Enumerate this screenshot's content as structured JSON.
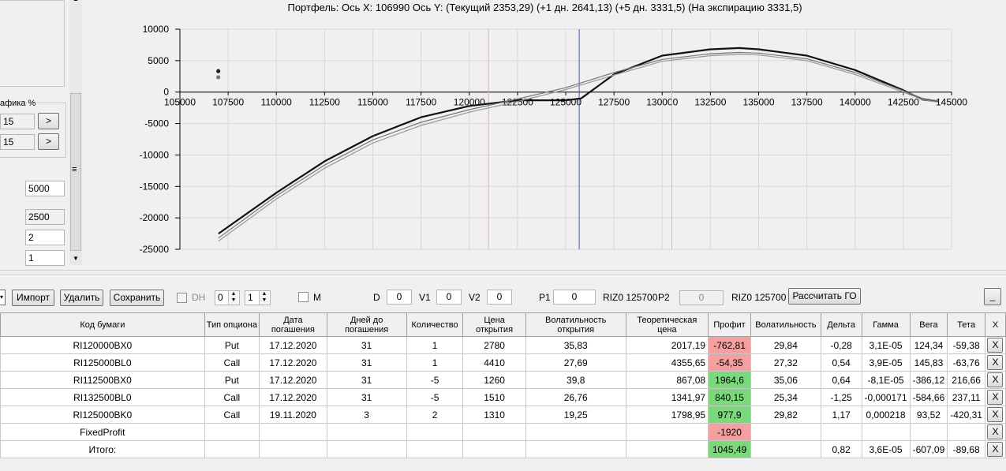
{
  "chart": {
    "title": "Портфель: Ось X: 106990 Ось Y:  (Текущий 2353,29)  (+1 дн. 2641,13)  (+5 дн. 3331,5)  (На экспирацию 3331,5)",
    "x_ticks": [
      "105000",
      "107500",
      "110000",
      "112500",
      "115000",
      "117500",
      "120000",
      "122500",
      "125000",
      "127500",
      "130000",
      "132500",
      "135000",
      "137500",
      "140000",
      "142500",
      "145000"
    ],
    "y_ticks": [
      "10000",
      "5000",
      "0",
      "-5000",
      "-10000",
      "-15000",
      "-20000",
      "-25000"
    ]
  },
  "chart_data": {
    "type": "line",
    "title": "Портфель: Ось X: 106990 Ось Y:  (Текущий 2353,29)  (+1 дн. 2641,13)  (+5 дн. 3331,5)  (На экспирацию 3331,5)",
    "xlim": [
      105000,
      145000
    ],
    "ylim": [
      -25000,
      10000
    ],
    "grid": true,
    "series": [
      {
        "x": [
          107000,
          110000,
          112500,
          115000,
          117500,
          120000,
          122500,
          125000,
          125800,
          127500,
          130000,
          132500,
          134000,
          135000,
          137500,
          140000,
          142500,
          143500,
          144300
        ],
        "y": [
          -22500,
          -16000,
          -11000,
          -7000,
          -4000,
          -2200,
          -1300,
          -1300,
          -1000,
          2800,
          5800,
          6800,
          7000,
          6800,
          5800,
          3500,
          300,
          -1200,
          -1500
        ]
      },
      {
        "x": [
          107000,
          110000,
          112500,
          115000,
          117500,
          120000,
          122500,
          125000,
          127500,
          130000,
          132500,
          134000,
          135000,
          137500,
          140000,
          142500,
          143500,
          144300
        ],
        "y": [
          -23200,
          -16500,
          -11600,
          -7600,
          -4800,
          -2800,
          -1100,
          700,
          3100,
          5200,
          6100,
          6300,
          6200,
          5300,
          3100,
          200,
          -1000,
          -1400
        ]
      },
      {
        "x": [
          107000,
          110000,
          112500,
          115000,
          117500,
          120000,
          122500,
          125000,
          127500,
          130000,
          132500,
          134000,
          135000,
          137500,
          140000,
          142500,
          143500,
          144300
        ],
        "y": [
          -23700,
          -17000,
          -12100,
          -8100,
          -5300,
          -3200,
          -1500,
          400,
          2700,
          4900,
          5800,
          6000,
          5900,
          5000,
          2800,
          0,
          -1200,
          -1600
        ]
      }
    ],
    "points": [
      {
        "x": 106990,
        "y": 3331.5
      },
      {
        "x": 106990,
        "y": 2353.29
      }
    ],
    "vertical_lines": [
      {
        "x": 121000,
        "color": "#f4a6b0"
      },
      {
        "x": 125700,
        "color": "#4a5aa0"
      },
      {
        "x": 130500,
        "color": "#f4a6b0"
      }
    ]
  },
  "left_panel": {
    "group_label": "афика %",
    "field1": "15",
    "field2": "15",
    "arrow_btn": ">",
    "field3": "5000",
    "field4": "2500",
    "field5": "2",
    "field6": "1",
    "grip": "≡",
    "scroll_up": "▲",
    "scroll_down": "▼"
  },
  "toolbar": {
    "dropdown_arrow": "▾",
    "import": "Импорт",
    "delete": "Удалить",
    "save": "Сохранить",
    "dh_label": "DH",
    "spin1": "0",
    "spin2": "1",
    "spin_up": "▲",
    "spin_down": "▼",
    "m_label": "M",
    "d_label": "D",
    "d_value": "0",
    "v1_label": "V1",
    "v1_value": "0",
    "v2_label": "V2",
    "v2_value": "0",
    "p1_label": "P1",
    "p1_value": "0",
    "riz1": "RIZ0 125700",
    "p2_label": "P2",
    "p2_value": "0",
    "riz2": "RIZ0 125700",
    "calc": "Рассчитать ГО",
    "minimize": "_"
  },
  "table": {
    "headers": [
      "Код бумаги",
      "Тип опциона",
      "Дата погашения",
      "Дней до погашения",
      "Количество",
      "Цена открытия",
      "Волатильность открытия",
      "Теоретическая цена",
      "Профит",
      "Волатильность",
      "Дельта",
      "Гамма",
      "Вега",
      "Тета",
      "X"
    ],
    "rows": [
      {
        "code": "RI120000BX0",
        "type": "Put",
        "date": "17.12.2020",
        "days": "31",
        "qty": "1",
        "open": "2780",
        "vol_open": "35,83",
        "theo": "2017,19",
        "profit": "-762,81",
        "profit_status": "neg",
        "vol": "29,84",
        "delta": "-0,28",
        "gamma": "3,1E-05",
        "vega": "124,34",
        "theta": "-59,38",
        "x": "X"
      },
      {
        "code": "RI125000BL0",
        "type": "Call",
        "date": "17.12.2020",
        "days": "31",
        "qty": "1",
        "open": "4410",
        "vol_open": "27,69",
        "theo": "4355,65",
        "profit": "-54,35",
        "profit_status": "neg",
        "vol": "27,32",
        "delta": "0,54",
        "gamma": "3,9E-05",
        "vega": "145,83",
        "theta": "-63,76",
        "x": "X"
      },
      {
        "code": "RI112500BX0",
        "type": "Put",
        "date": "17.12.2020",
        "days": "31",
        "qty": "-5",
        "open": "1260",
        "vol_open": "39,8",
        "theo": "867,08",
        "profit": "1964,6",
        "profit_status": "pos",
        "vol": "35,06",
        "delta": "0,64",
        "gamma": "-8,1E-05",
        "vega": "-386,12",
        "theta": "216,66",
        "x": "X"
      },
      {
        "code": "RI132500BL0",
        "type": "Call",
        "date": "17.12.2020",
        "days": "31",
        "qty": "-5",
        "open": "1510",
        "vol_open": "26,76",
        "theo": "1341,97",
        "profit": "840,15",
        "profit_status": "pos",
        "vol": "25,34",
        "delta": "-1,25",
        "gamma": "-0,000171",
        "vega": "-584,66",
        "theta": "237,11",
        "x": "X"
      },
      {
        "code": "RI125000BK0",
        "type": "Call",
        "date": "19.11.2020",
        "days": "3",
        "qty": "2",
        "open": "1310",
        "vol_open": "19,25",
        "theo": "1798,95",
        "profit": "977,9",
        "profit_status": "pos",
        "vol": "29,82",
        "delta": "1,17",
        "gamma": "0,000218",
        "vega": "93,52",
        "theta": "-420,31",
        "x": "X"
      },
      {
        "code": "FixedProfit",
        "type": "",
        "date": "",
        "days": "",
        "qty": "",
        "open": "",
        "vol_open": "",
        "theo": "",
        "profit": "-1920",
        "profit_status": "neg",
        "vol": "",
        "delta": "",
        "gamma": "",
        "vega": "",
        "theta": "",
        "x": "X"
      },
      {
        "code": "Итого:",
        "type": "",
        "date": "",
        "days": "",
        "qty": "",
        "open": "",
        "vol_open": "",
        "theo": "",
        "profit": "1045,49",
        "profit_status": "pos",
        "vol": "",
        "delta": "0,82",
        "gamma": "3,6E-05",
        "vega": "-607,09",
        "theta": "-89,68",
        "x": "X"
      }
    ]
  },
  "colors": {
    "profit_negative": "#f4a0a0",
    "profit_positive": "#7bd97b",
    "grid": "#d8d8d8"
  }
}
